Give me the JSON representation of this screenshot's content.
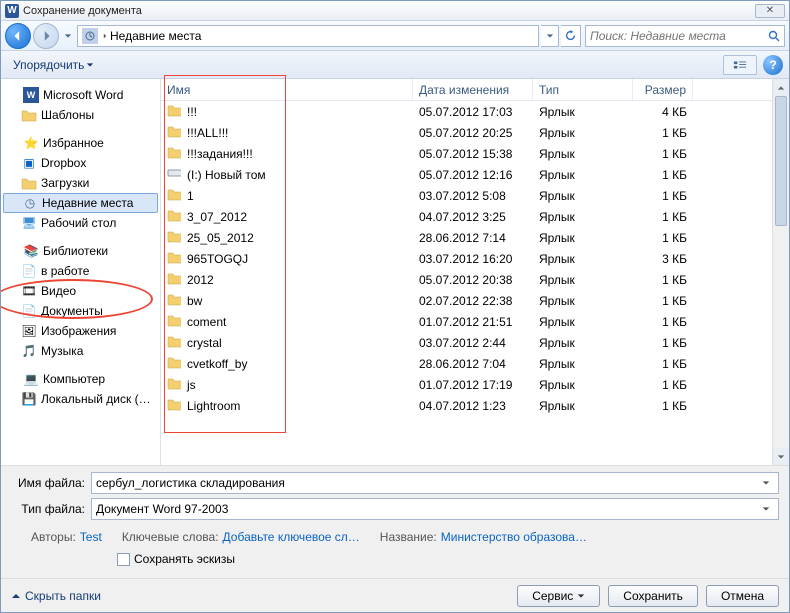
{
  "title": "Сохранение документа",
  "breadcrumb": "Недавние места",
  "search_placeholder": "Поиск: Недавние места",
  "toolbar": {
    "organize": "Упорядочить",
    "help": "?"
  },
  "sidebar": {
    "word": "Microsoft Word",
    "templates": "Шаблоны",
    "fav": "Избранное",
    "dropbox": "Dropbox",
    "downloads": "Загрузки",
    "recent": "Недавние места",
    "desktop": "Рабочий стол",
    "libs": "Библиотеки",
    "inwork": "в работе",
    "video": "Видео",
    "docs": "Документы",
    "images": "Изображения",
    "music": "Музыка",
    "computer": "Компьютер",
    "localdisk": "Локальный диск (…"
  },
  "columns": {
    "name": "Имя",
    "date": "Дата изменения",
    "type": "Тип",
    "size": "Размер"
  },
  "rows": [
    {
      "icon": "folder",
      "name": "!!!",
      "date": "05.07.2012 17:03",
      "type": "Ярлык",
      "size": "4 КБ"
    },
    {
      "icon": "folder",
      "name": "!!!ALL!!!",
      "date": "05.07.2012 20:25",
      "type": "Ярлык",
      "size": "1 КБ"
    },
    {
      "icon": "folder",
      "name": "!!!задания!!!",
      "date": "05.07.2012 15:38",
      "type": "Ярлык",
      "size": "1 КБ"
    },
    {
      "icon": "drive",
      "name": "(I:) Новый том",
      "date": "05.07.2012 12:16",
      "type": "Ярлык",
      "size": "1 КБ"
    },
    {
      "icon": "folder",
      "name": "1",
      "date": "03.07.2012 5:08",
      "type": "Ярлык",
      "size": "1 КБ"
    },
    {
      "icon": "folder",
      "name": "3_07_2012",
      "date": "04.07.2012 3:25",
      "type": "Ярлык",
      "size": "1 КБ"
    },
    {
      "icon": "folder",
      "name": "25_05_2012",
      "date": "28.06.2012 7:14",
      "type": "Ярлык",
      "size": "1 КБ"
    },
    {
      "icon": "folder",
      "name": "965TOGQJ",
      "date": "03.07.2012 16:20",
      "type": "Ярлык",
      "size": "3 КБ"
    },
    {
      "icon": "folder",
      "name": "2012",
      "date": "05.07.2012 20:38",
      "type": "Ярлык",
      "size": "1 КБ"
    },
    {
      "icon": "folder",
      "name": "bw",
      "date": "02.07.2012 22:38",
      "type": "Ярлык",
      "size": "1 КБ"
    },
    {
      "icon": "folder",
      "name": "coment",
      "date": "01.07.2012 21:51",
      "type": "Ярлык",
      "size": "1 КБ"
    },
    {
      "icon": "folder",
      "name": "crystal",
      "date": "03.07.2012 2:44",
      "type": "Ярлык",
      "size": "1 КБ"
    },
    {
      "icon": "folder",
      "name": "cvetkoff_by",
      "date": "28.06.2012 7:04",
      "type": "Ярлык",
      "size": "1 КБ"
    },
    {
      "icon": "folder",
      "name": "js",
      "date": "01.07.2012 17:19",
      "type": "Ярлык",
      "size": "1 КБ"
    },
    {
      "icon": "folder",
      "name": "Lightroom",
      "date": "04.07.2012 1:23",
      "type": "Ярлык",
      "size": "1 КБ"
    }
  ],
  "filename_label": "Имя файла:",
  "filename_value": "сербул_логистика складирования",
  "filetype_label": "Тип файла:",
  "filetype_value": "Документ Word 97-2003",
  "meta": {
    "authors_l": "Авторы:",
    "authors_v": "Test",
    "keywords_l": "Ключевые слова:",
    "keywords_v": "Добавьте ключевое сл…",
    "title_l": "Название:",
    "title_v": "Министерство образова…"
  },
  "save_thumb": "Сохранять эскизы",
  "footer": {
    "hide": "Скрыть папки",
    "service": "Сервис",
    "save": "Сохранить",
    "cancel": "Отмена"
  }
}
